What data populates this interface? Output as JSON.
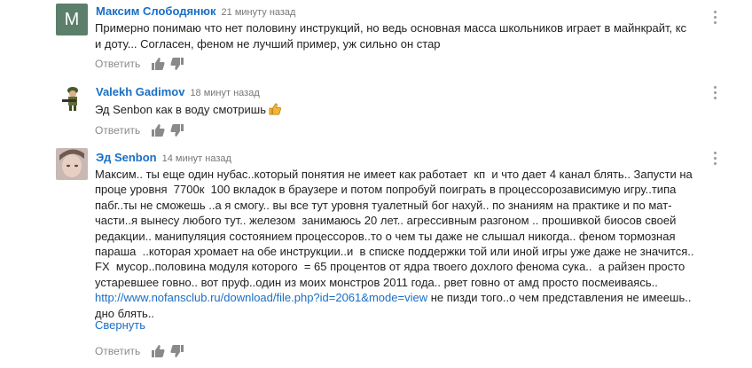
{
  "comments": [
    {
      "author": "Максим Слободянюк",
      "time": "21 минуту назад",
      "avatar_letter": "M",
      "lines": [
        "Примерно понимаю что нет половину инструкций, но ведь основная масса школьников играет в майнкрайт, кс",
        "и доту... Согласен, феном не лучший пример, уж сильно он стар"
      ],
      "reply_label": "Ответить"
    },
    {
      "author": "Valekh Gadimov",
      "time": "18 минут назад",
      "text": "Эд Senbon как в воду смотришь",
      "reply_label": "Ответить"
    },
    {
      "author": "Эд Senbon",
      "time": "14 минут назад",
      "lines": [
        "Максим.. ты еще один нубас..который понятия не имеет как работает  кп  и что дает 4 канал блять.. Запусти на",
        "проце уровня  7700к  100 вкладок в браузере и потом попробуй поиграть в процессорозависимую игру..типа",
        "пабг..ты не сможешь ..а я смогу.. вы все тут уровня туалетный бог нахуй.. по знаниям на практике и по мат-",
        "части..я вынесу любого тут.. железом  занимаюсь 20 лет.. агрессивным разгоном .. прошивкой биосов своей",
        "редакции.. манипуляция состоянием процессоров..то о чем ты даже не слышал никогда.. феном тормозная",
        "параша  ..которая хромает на обе инструкции..и  в списке поддержки той или иной игры уже даже не значится..",
        "FX  мусор..половина модуля которого  = 65 процентов от ядра твоего дохлого феномa сука..  а райзен просто",
        "устаревшее говно.. вот пруф..один из моих монстров 2011 года.. рвет говно от амд просто посмеиваясь.."
      ],
      "link": "http://www.nofansclub.ru/download/file.php?id=2061&mode=view",
      "link_tail": " не пизди того..о чем представления не имеешь..",
      "last_line": "дно блять..",
      "collapse_label": "Свернуть",
      "reply_label": "Ответить"
    }
  ],
  "colors": {
    "author": "#1a6fc4",
    "link": "#1a6fc4",
    "muted": "#8a8a8a"
  }
}
